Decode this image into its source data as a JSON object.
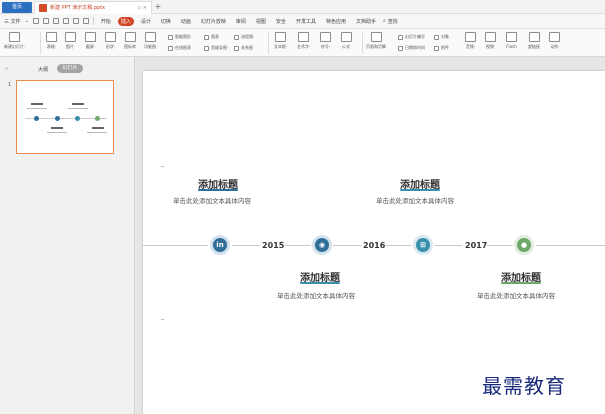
{
  "titlebar": {
    "home_tab": "首页",
    "doc_tab": "新建 PPT 演示文稿.pptx",
    "doc_tab_controls": "◇ ×",
    "new_tab": "+"
  },
  "menubar": {
    "file": "三 文件",
    "quick_chevron": "⌄",
    "tabs": [
      "开始",
      "插入",
      "设计",
      "切换",
      "动画",
      "幻灯片放映",
      "审阅",
      "视图",
      "安全",
      "开发工具",
      "特色应用",
      "文档助手"
    ],
    "active_tab": 1,
    "search": "查找"
  },
  "ribbon": {
    "new_slide": "新建幻灯片·",
    "table": "表格·",
    "picture": "图片·",
    "screenshot": "截屏·",
    "shape": "形状·",
    "icons": "图标库",
    "function_chart": "功能图·",
    "smart_graphic": "智能图形",
    "chart": "图表",
    "flowchart": "流程图·",
    "online_chart": "在线图表",
    "mindmap": "思维导图·",
    "relation_chart": "关系图",
    "textbox": "文本框·",
    "art_text": "艺术字·",
    "symbol": "符号·",
    "formula": "公式·",
    "header_footer": "页眉和页脚",
    "slide_number": "幻灯片编号",
    "date_time": "日期和时间",
    "object": "对象",
    "attachment": "附件",
    "audio": "音频·",
    "video": "视频·",
    "flash": "Flash",
    "hyperlink": "超链接",
    "action": "动作"
  },
  "leftpanel": {
    "outline_tab": "大纲",
    "slide_tab": "幻灯片",
    "thumb_number": "1",
    "collapse": "«"
  },
  "slide": {
    "blocks": [
      {
        "title": "添加标题",
        "body": "单击此处添加文本具体内容"
      },
      {
        "title": "添加标题",
        "body": "单击此处添加文本具体内容"
      },
      {
        "title": "添加标题",
        "body": "单击此处添加文本具体内容"
      },
      {
        "title": "添加标题",
        "body": "单击此处添加文本具体内容"
      }
    ],
    "years": [
      "2015",
      "2016",
      "2017"
    ],
    "node_colors": [
      "#2f6f9a",
      "#2f6f9a",
      "#3a8fae",
      "#6fa86a"
    ],
    "accent_colors": [
      "#2f6f9a",
      "#3a8fae",
      "#3a8fae",
      "#6fa86a"
    ],
    "node_icons": [
      "linkedin-icon",
      "soccer-ball-icon",
      "windows-icon",
      "person-icon"
    ],
    "node_glyphs": [
      "in",
      "◉",
      "⊞",
      "●"
    ]
  },
  "watermark": "最需教育"
}
